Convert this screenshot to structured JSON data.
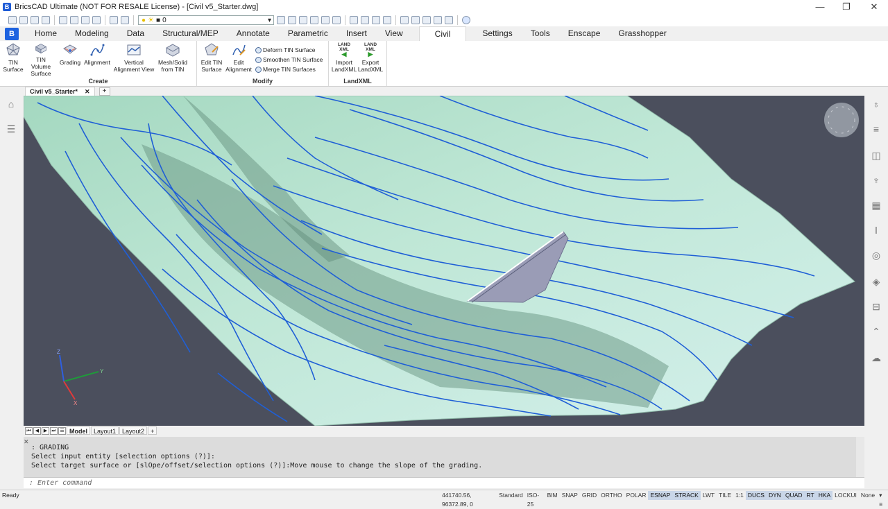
{
  "window": {
    "title": "BricsCAD Ultimate (NOT FOR RESALE License) - [Civil v5_Starter.dwg]",
    "controls": [
      "—",
      "❐",
      "✕"
    ]
  },
  "quick_access": {
    "layer_value": "0"
  },
  "app_button": "B",
  "ribbon_tabs": [
    "Home",
    "Modeling",
    "Data",
    "Structural/MEP",
    "Annotate",
    "Parametric",
    "Insert",
    "View",
    "Civil",
    "Settings",
    "Tools",
    "Enscape",
    "Grasshopper"
  ],
  "active_tab": "Civil",
  "ribbon": {
    "create": {
      "title": "Create",
      "tools": [
        {
          "label1": "TIN",
          "label2": "Surface"
        },
        {
          "label1": "TIN Volume",
          "label2": "Surface"
        },
        {
          "label1": "Grading",
          "label2": ""
        },
        {
          "label1": "Alignment",
          "label2": ""
        },
        {
          "label1": "Vertical",
          "label2": "Alignment View"
        },
        {
          "label1": "Mesh/Solid",
          "label2": "from TIN"
        }
      ]
    },
    "modify": {
      "title": "Modify",
      "tools": [
        {
          "label1": "Edit TIN",
          "label2": "Surface"
        },
        {
          "label1": "Edit",
          "label2": "Alignment"
        }
      ],
      "small_tools": [
        "Deform TIN Surface",
        "Smoothen TIN Surface",
        "Merge TIN Surfaces"
      ]
    },
    "landxml": {
      "title": "LandXML",
      "tools": [
        {
          "icon_text": "LAND XML",
          "label1": "Import",
          "label2": "LandXML"
        },
        {
          "icon_text": "LAND XML",
          "label1": "Export",
          "label2": "LandXML"
        }
      ]
    }
  },
  "document_tab": {
    "label": "Civil v5_Starter*",
    "close": "✕",
    "add": "+"
  },
  "layout_tabs": [
    "Model",
    "Layout1",
    "Layout2",
    "+"
  ],
  "command_history": [
    ": GRADING",
    "Select input entity [selection options (?)]:",
    "Select target surface or [slOpe/offset/selection options (?)]:Move mouse to change the slope of the grading."
  ],
  "command_prompt": ": Enter command",
  "status": {
    "left": "Ready",
    "coords": "441740.56, 96372.89, 0",
    "items": [
      {
        "label": "Standard",
        "on": false
      },
      {
        "label": "ISO-25",
        "on": false
      },
      {
        "label": "BIM",
        "on": false
      },
      {
        "label": "SNAP",
        "on": false
      },
      {
        "label": "GRID",
        "on": false
      },
      {
        "label": "ORTHO",
        "on": false
      },
      {
        "label": "POLAR",
        "on": false
      },
      {
        "label": "ESNAP",
        "on": true
      },
      {
        "label": "STRACK",
        "on": true
      },
      {
        "label": "LWT",
        "on": false
      },
      {
        "label": "TILE",
        "on": false
      },
      {
        "label": "1:1",
        "on": false
      },
      {
        "label": "DUCS",
        "on": true
      },
      {
        "label": "DYN",
        "on": true
      },
      {
        "label": "QUAD",
        "on": true
      },
      {
        "label": "RT",
        "on": true
      },
      {
        "label": "HKA",
        "on": true
      },
      {
        "label": "LOCKUI",
        "on": false
      },
      {
        "label": "None",
        "on": false
      }
    ]
  },
  "axes": {
    "x": "X",
    "y": "Y",
    "z": "Z"
  },
  "colors": {
    "viewport_bg": "#4b4f5d",
    "terrain": "#b5e3cf",
    "contours": "#1f5fd6",
    "accent": "#1e63e0"
  }
}
